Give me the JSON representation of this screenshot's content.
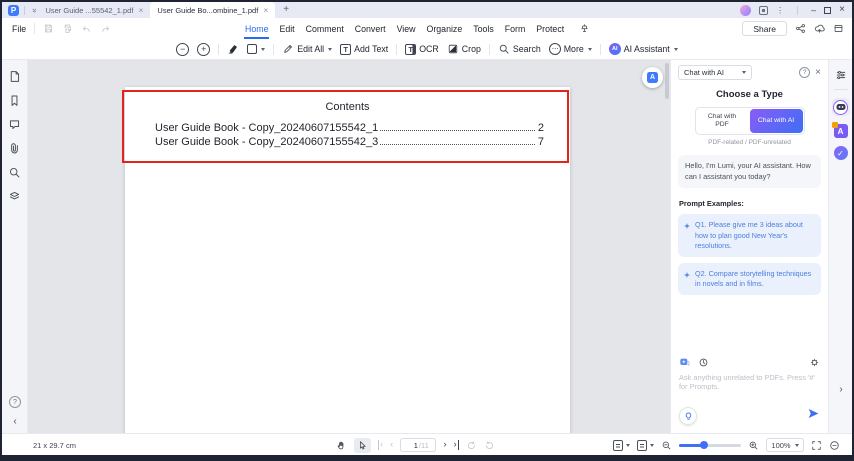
{
  "titlebar": {
    "logo_letter": "P",
    "tabs": [
      {
        "label": "User Guide ...55542_1.pdf"
      },
      {
        "label": "User Guide Bo...ombine_1.pdf"
      }
    ]
  },
  "menubar": {
    "file_label": "File",
    "items": [
      "Home",
      "Edit",
      "Comment",
      "Convert",
      "View",
      "Organize",
      "Tools",
      "Form",
      "Protect"
    ],
    "share_label": "Share"
  },
  "toolbar": {
    "edit_all_label": "Edit All",
    "add_text_label": "Add Text",
    "ocr_label": "OCR",
    "crop_label": "Crop",
    "search_label": "Search",
    "more_label": "More",
    "ai_assistant_label": "AI Assistant",
    "ai_badge": "AI",
    "t_glyph": "T"
  },
  "document": {
    "title": "Contents",
    "toc_entries": [
      {
        "label": "User Guide Book - Copy_20240607155542_1",
        "page": "2"
      },
      {
        "label": "User Guide Book - Copy_20240607155542_3",
        "page": "7"
      }
    ]
  },
  "ai_panel": {
    "mode_select_value": "Chat with AI",
    "choose_type_title": "Choose a Type",
    "chat_with_pdf_label": "Chat with PDF",
    "chat_with_ai_label": "Chat with AI",
    "type_caption": "PDF-related / PDF-unrelated",
    "greeting": "Hello, I'm Lumi, your AI assistant. How can I assistant you today?",
    "prompt_examples_label": "Prompt Examples:",
    "prompts": [
      "Q1. Please give me 3 ideas about how to plan good New Year's resolutions.",
      "Q2. Compare storytelling techniques in novels and in films."
    ],
    "input_placeholder": "Ask anything unrelated to PDFs. Press '#' for Prompts."
  },
  "statusbar": {
    "page_size": "21 x 29.7 cm",
    "current_page": "1",
    "page_total": "/11",
    "zoom_level": "100%"
  }
}
